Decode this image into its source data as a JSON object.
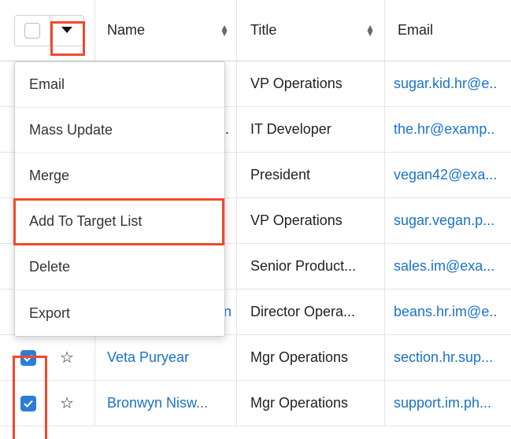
{
  "header": {
    "name_label": "Name",
    "title_label": "Title",
    "email_label": "Email",
    "sort_icon": "sort-icon",
    "dropdown_icon": "caret-down-icon"
  },
  "menu": {
    "items": [
      "Email",
      "Mass Update",
      "Merge",
      "Add To Target List",
      "Delete",
      "Export"
    ],
    "highlighted_item": "Add To Target List"
  },
  "rows": [
    {
      "name": "",
      "title": "VP Operations",
      "email": "sugar.kid.hr@e..",
      "checked": false
    },
    {
      "name": ".",
      "title": "IT Developer",
      "email": "the.hr@examp..",
      "checked": false
    },
    {
      "name": "",
      "title": "President",
      "email": "vegan42@exa...",
      "checked": false
    },
    {
      "name": "",
      "title": "VP Operations",
      "email": "sugar.vegan.p...",
      "checked": false
    },
    {
      "name": "",
      "title": "Senior Product...",
      "email": "sales.im@exa...",
      "checked": false
    },
    {
      "name": "n",
      "title": "Director Opera...",
      "email": "beans.hr.im@e..",
      "checked": false
    },
    {
      "name": "Veta Puryear",
      "title": "Mgr Operations",
      "email": "section.hr.sup...",
      "checked": true
    },
    {
      "name": "Bronwyn Nisw...",
      "title": "Mgr Operations",
      "email": "support.im.ph...",
      "checked": true
    }
  ],
  "colors": {
    "link": "#1a73c8",
    "highlight": "#f04a2a",
    "checkbox_checked": "#2b7dd8"
  }
}
